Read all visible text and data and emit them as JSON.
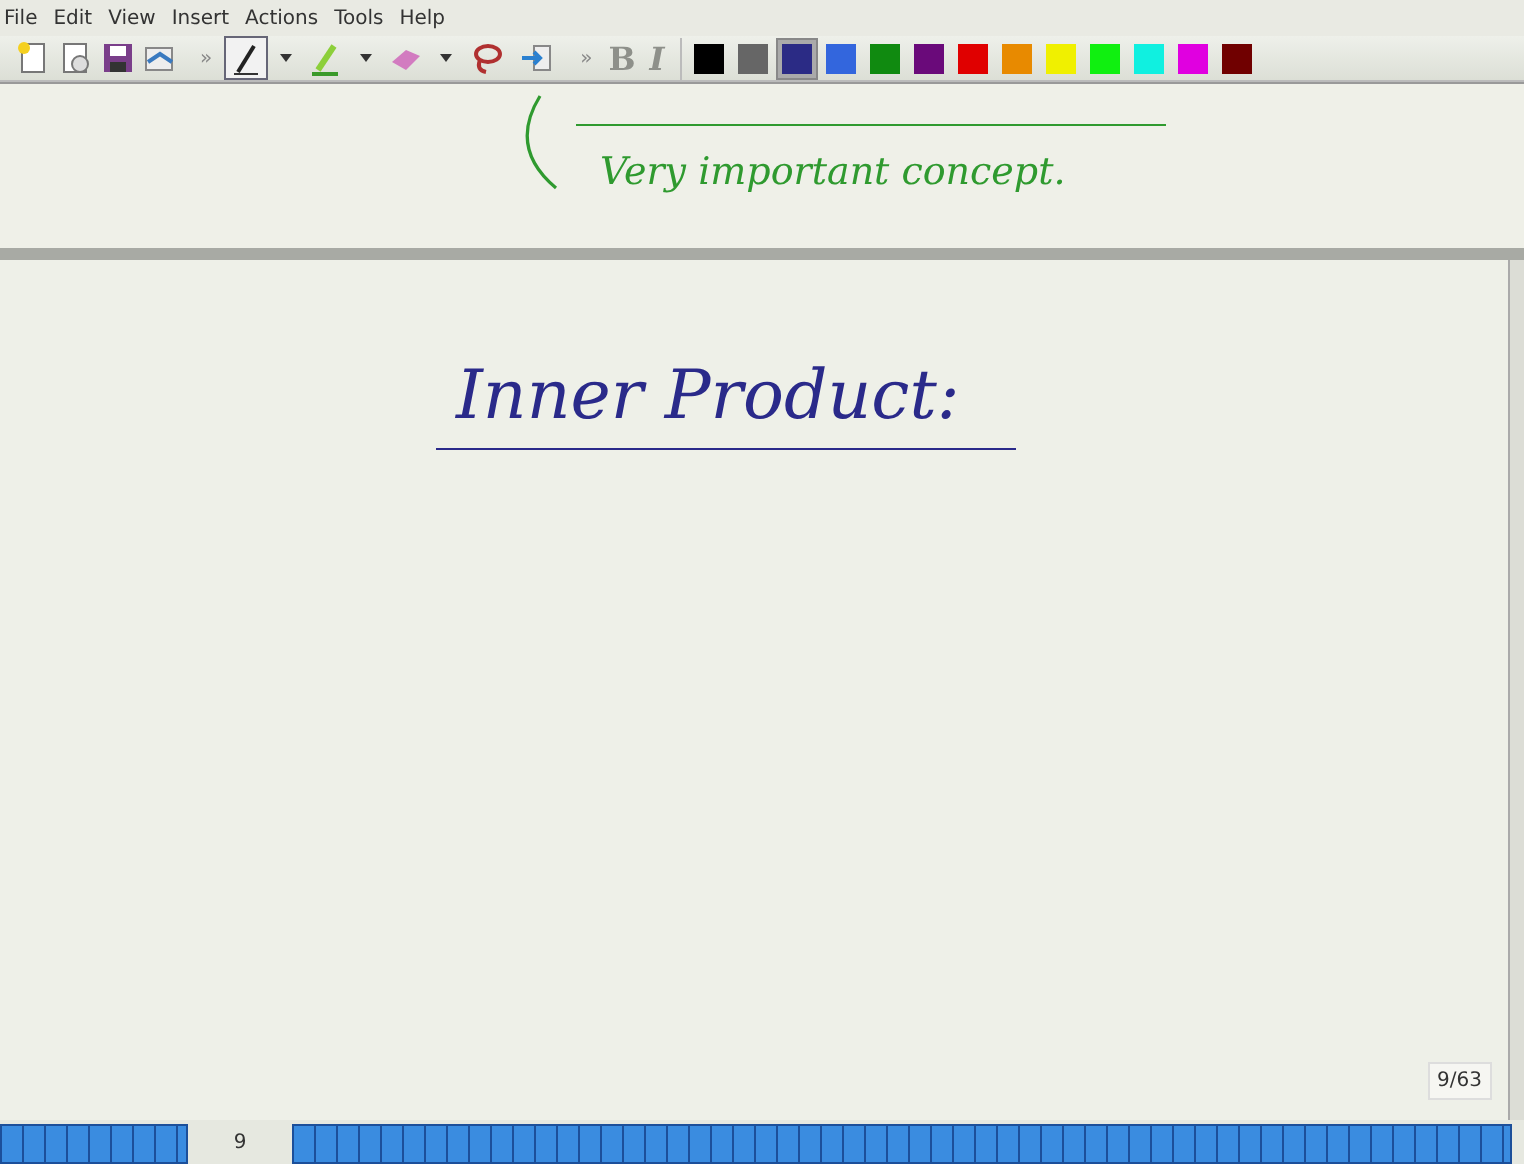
{
  "menu": [
    "File",
    "Edit",
    "View",
    "Insert",
    "Actions",
    "Tools",
    "Help"
  ],
  "toolbar": {
    "overflow": [
      "»",
      "»"
    ],
    "file_tools": [
      {
        "kind": "new"
      },
      {
        "kind": "open"
      },
      {
        "kind": "save"
      },
      {
        "kind": "email"
      }
    ],
    "pen_tools": [
      {
        "kind": "pen",
        "selected": true
      },
      {
        "kind": "highlighter",
        "selected": false
      },
      {
        "kind": "eraser",
        "selected": false
      },
      {
        "kind": "lasso",
        "selected": false
      },
      {
        "kind": "insert",
        "selected": false
      }
    ],
    "format": [
      {
        "label": "B",
        "disabled": true
      },
      {
        "label": "I",
        "disabled": true
      }
    ],
    "colors": [
      {
        "color": "#000000",
        "selected": false
      },
      {
        "color": "#666666",
        "selected": false
      },
      {
        "color": "#2b2b85",
        "selected": true
      },
      {
        "color": "#3366dd",
        "selected": false
      },
      {
        "color": "#108a10",
        "selected": false
      },
      {
        "color": "#6a0a7a",
        "selected": false
      },
      {
        "color": "#e00000",
        "selected": false
      },
      {
        "color": "#e88a00",
        "selected": false
      },
      {
        "color": "#f0f000",
        "selected": false
      },
      {
        "color": "#10f010",
        "selected": false
      },
      {
        "color": "#10f0e0",
        "selected": false
      },
      {
        "color": "#e000e0",
        "selected": false
      },
      {
        "color": "#700000",
        "selected": false
      }
    ]
  },
  "previous_page": {
    "ink": [
      {
        "text": "Very important concept.",
        "color": "#2f9a2f"
      }
    ]
  },
  "current_page": {
    "ink": [
      {
        "text": "Inner Product:",
        "color": "#2a2a8a"
      }
    ],
    "page_indicator": "9/63"
  },
  "page_strip": {
    "current_page": "9"
  }
}
